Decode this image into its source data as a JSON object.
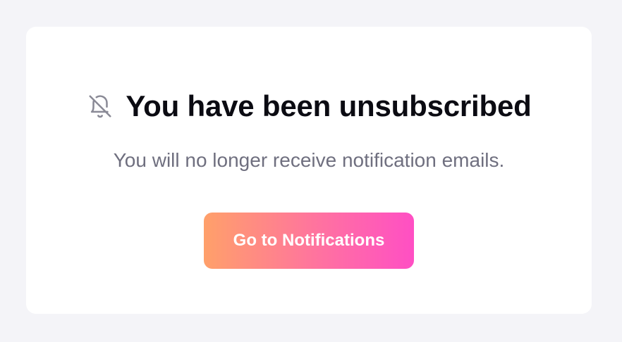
{
  "card": {
    "icon": "bell-off-icon",
    "title": "You have been unsubscribed",
    "message": "You will no longer receive notification emails.",
    "button_label": "Go to Notifications"
  },
  "colors": {
    "background": "#f4f4f8",
    "card": "#ffffff",
    "title": "#0b0b12",
    "message": "#6f6f7f",
    "icon": "#8a8a96",
    "button_gradient_start": "#ffa06a",
    "button_gradient_end": "#ff4fc4"
  }
}
